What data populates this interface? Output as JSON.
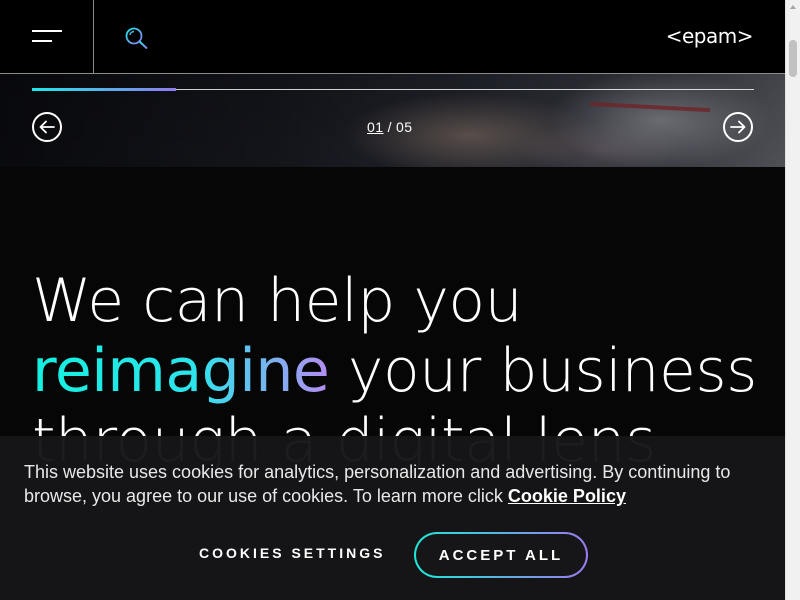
{
  "header": {
    "logo_text": "<epam>",
    "menu_icon": "hamburger-icon",
    "search_icon": "search-icon"
  },
  "slider": {
    "current": "01",
    "separator": "/",
    "total": "05",
    "progress": 0.2,
    "prev_icon": "arrow-left-icon",
    "next_icon": "arrow-right-icon"
  },
  "hero": {
    "line1": "We can help you",
    "line2_accent": "reimagine",
    "line2_rest": " your business",
    "line3": "through a digital lens"
  },
  "cookie_banner": {
    "text": "This website uses cookies for analytics, personalization and advertising. By continuing to browse, you agree to our use of cookies. To learn more click ",
    "link_label": "Cookie Policy",
    "settings_label": "COOKIES SETTINGS",
    "accept_label": "ACCEPT ALL"
  },
  "colors": {
    "accent_cyan": "#1ee8e8",
    "accent_violet": "#9b7cf0",
    "background": "#060606"
  }
}
